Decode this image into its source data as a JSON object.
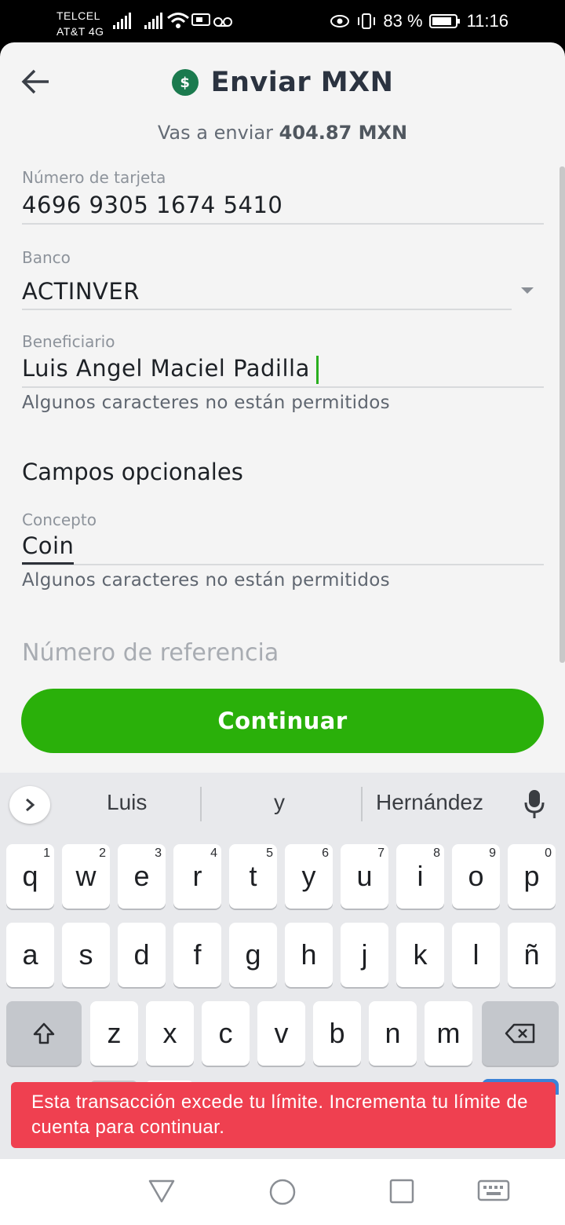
{
  "status_bar": {
    "carrier1": "TELCEL",
    "carrier2": "AT&T 4G",
    "battery_percent": "83 %",
    "time": "11:16"
  },
  "header": {
    "title": "Enviar MXN",
    "currency_icon": "$",
    "subtitle_prefix": "Vas a enviar",
    "subtitle_amount": "404.87 MXN"
  },
  "form": {
    "card_label": "Número de tarjeta",
    "card_value": "4696 9305 1674 5410",
    "bank_label": "Banco",
    "bank_value": "ACTINVER",
    "beneficiary_label": "Beneficiario",
    "beneficiary_value": "Luis Angel Maciel Padilla",
    "beneficiary_hint": "Algunos caracteres no están permitidos",
    "optional_title": "Campos opcionales",
    "concept_label": "Concepto",
    "concept_value": "Coin",
    "concept_hint": "Algunos caracteres no están permitidos",
    "reference_placeholder": "Número de referencia",
    "continue_label": "Continuar"
  },
  "keyboard": {
    "suggestions": [
      "Luis",
      "y",
      "Hernández"
    ],
    "row1": [
      "q",
      "w",
      "e",
      "r",
      "t",
      "y",
      "u",
      "i",
      "o",
      "p"
    ],
    "row1_nums": [
      "1",
      "2",
      "3",
      "4",
      "5",
      "6",
      "7",
      "8",
      "9",
      "0"
    ],
    "row2": [
      "a",
      "s",
      "d",
      "f",
      "g",
      "h",
      "j",
      "k",
      "l",
      "ñ"
    ],
    "row3": [
      "z",
      "x",
      "c",
      "v",
      "b",
      "n",
      "m"
    ]
  },
  "toast": {
    "message": "Esta transacción excede tu límite. Incrementa tu límite de cuenta para continuar."
  },
  "colors": {
    "accent_green": "#2ab00a",
    "error_red": "#ef4050",
    "icon_green": "#1b7a4e"
  }
}
